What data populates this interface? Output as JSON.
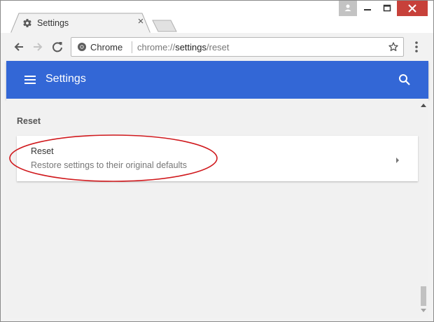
{
  "tab": {
    "title": "Settings",
    "icon": "gear-icon"
  },
  "address_bar": {
    "origin_label": "Chrome",
    "url_prefix": "chrome://",
    "url_host": "settings",
    "url_path": "/reset"
  },
  "settings_header": {
    "title": "Settings"
  },
  "section": {
    "title": "Reset"
  },
  "reset_card": {
    "title": "Reset",
    "subtitle": "Restore settings to their original defaults"
  },
  "colors": {
    "header_blue": "#3367d6",
    "annotation_red": "#d0191d",
    "close_button_red": "#c7413a"
  }
}
